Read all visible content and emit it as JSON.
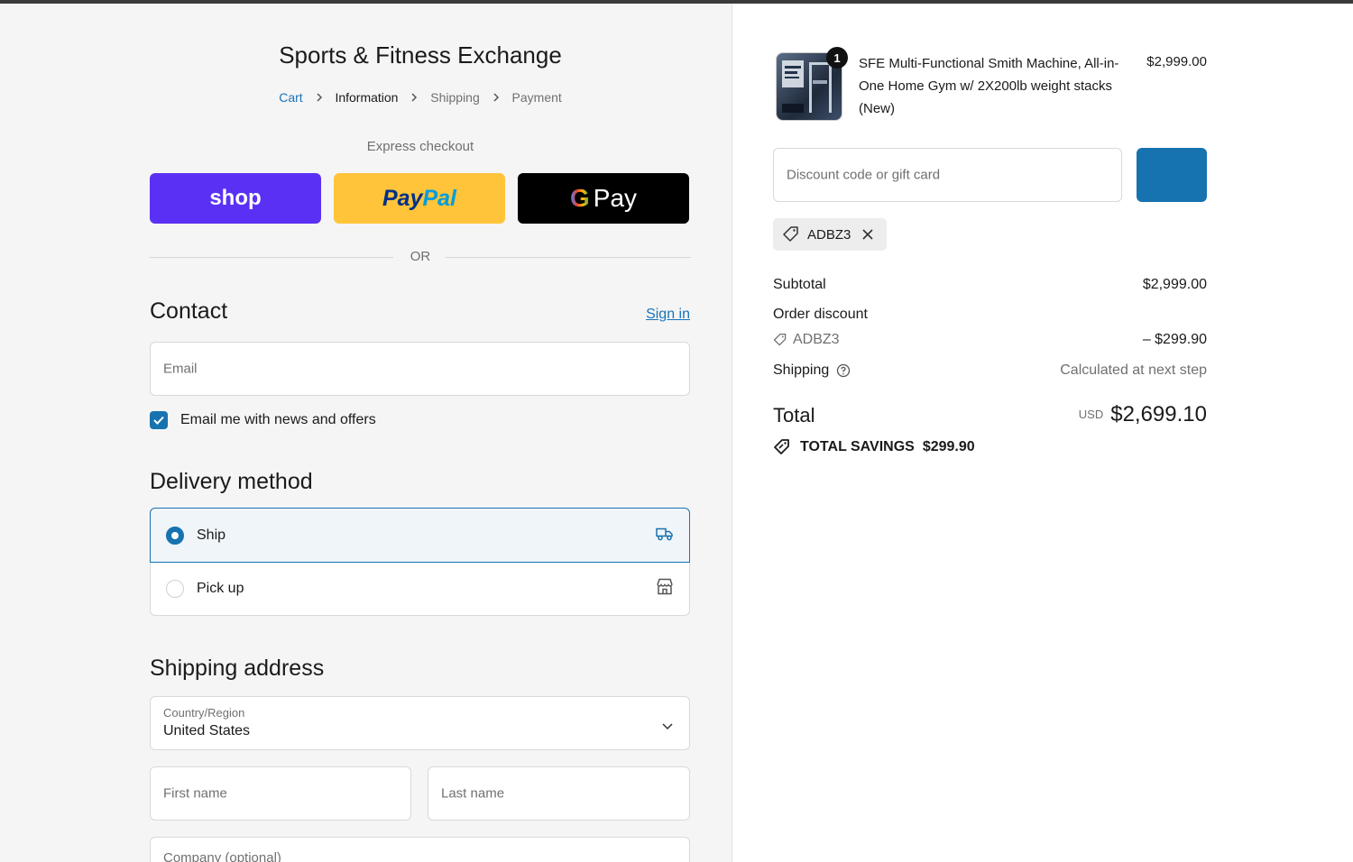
{
  "store": {
    "name": "Sports & Fitness Exchange"
  },
  "breadcrumb": {
    "cart": "Cart",
    "information": "Information",
    "shipping": "Shipping",
    "payment": "Payment"
  },
  "express": {
    "label": "Express checkout",
    "shop_label": "shop",
    "paypal_part1": "Pay",
    "paypal_part2": "Pal",
    "gpay_g": "G",
    "gpay_label": "Pay",
    "or_label": "OR"
  },
  "contact": {
    "title": "Contact",
    "sign_in": "Sign in",
    "email_placeholder": "Email",
    "newsletter_label": "Email me with news and offers",
    "newsletter_checked": true
  },
  "delivery": {
    "title": "Delivery method",
    "options": [
      {
        "label": "Ship",
        "selected": true,
        "icon": "truck-icon"
      },
      {
        "label": "Pick up",
        "selected": false,
        "icon": "store-icon"
      }
    ]
  },
  "shipping_address": {
    "title": "Shipping address",
    "country_label": "Country/Region",
    "country_value": "United States",
    "first_name_placeholder": "First name",
    "last_name_placeholder": "Last name",
    "company_placeholder": "Company (optional)"
  },
  "order": {
    "item": {
      "quantity": "1",
      "title": "SFE Multi-Functional Smith Machine, All-in-One Home Gym w/ 2X200lb weight stacks (New)",
      "price": "$2,999.00"
    },
    "discount_placeholder": "Discount code or gift card",
    "applied_code": "ADBZ3",
    "subtotal_label": "Subtotal",
    "subtotal_value": "$2,999.00",
    "order_discount_label": "Order discount",
    "discount_code": "ADBZ3",
    "discount_value": "– $299.90",
    "shipping_label": "Shipping",
    "shipping_value": "Calculated at next step",
    "total_label": "Total",
    "currency": "USD",
    "total_value": "$2,699.10",
    "savings_label": "TOTAL SAVINGS",
    "savings_value": "$299.90"
  },
  "colors": {
    "accent": "#1773b0",
    "shop_purple": "#5a31f4",
    "paypal_yellow": "#ffc439"
  }
}
